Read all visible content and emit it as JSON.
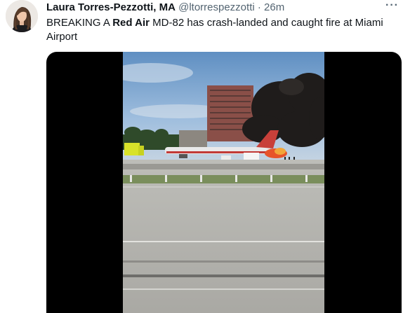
{
  "author": {
    "display_name": "Laura Torres-Pezzotti, MA",
    "handle": "@ltorrespezzotti",
    "separator": "·",
    "timestamp": "26m"
  },
  "menu": {
    "more_label": "···"
  },
  "tweet": {
    "text_parts": [
      {
        "text": "BREAKING A ",
        "bold": false
      },
      {
        "text": "Red Air",
        "bold": true
      },
      {
        "text": " MD-82 has crash-landed and caught fire at Miami Airport",
        "bold": false
      }
    ]
  },
  "media": {
    "type": "video",
    "content": "video frame of a burning airliner on an airport runway with black smoke"
  },
  "colors": {
    "text": "#0f1419",
    "secondary": "#536471",
    "media_bg": "#000000"
  }
}
